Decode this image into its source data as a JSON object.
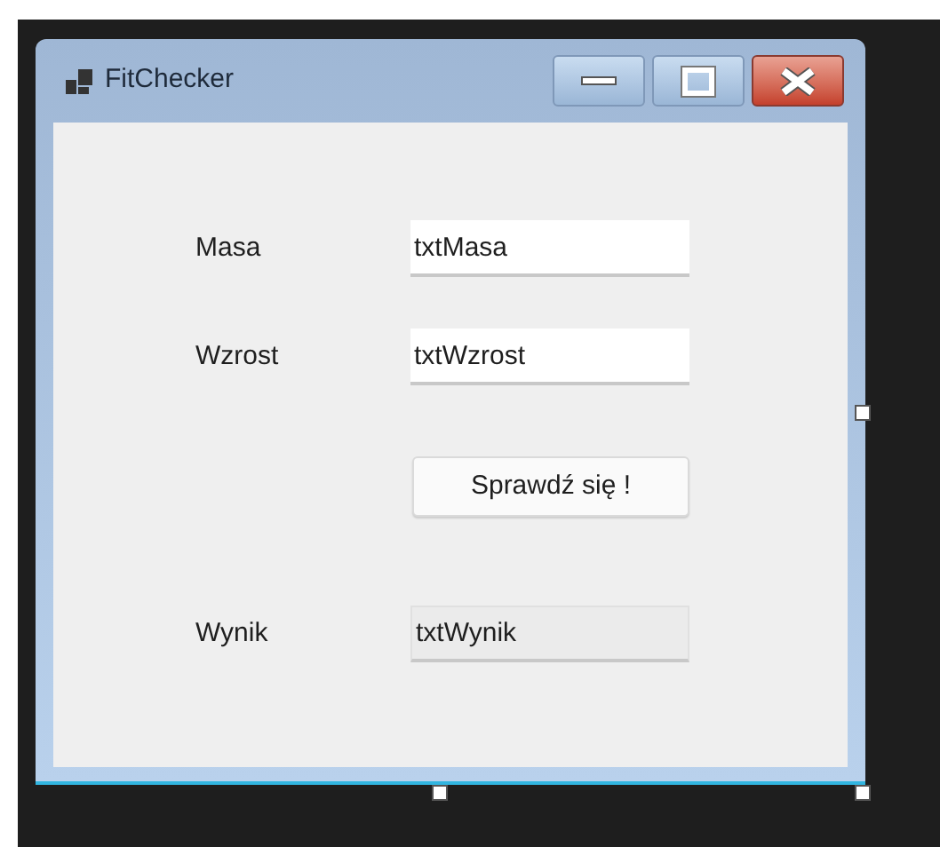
{
  "window": {
    "title": "FitChecker"
  },
  "controls": [
    {
      "kind": "field",
      "label": "Masa",
      "value": "txtMasa",
      "readonly": false
    },
    {
      "kind": "field",
      "label": "Wzrost",
      "value": "txtWzrost",
      "readonly": false
    },
    {
      "kind": "button",
      "label": "Sprawdź się !"
    },
    {
      "kind": "field",
      "label": "Wynik",
      "value": "txtWynik",
      "readonly": true
    }
  ]
}
